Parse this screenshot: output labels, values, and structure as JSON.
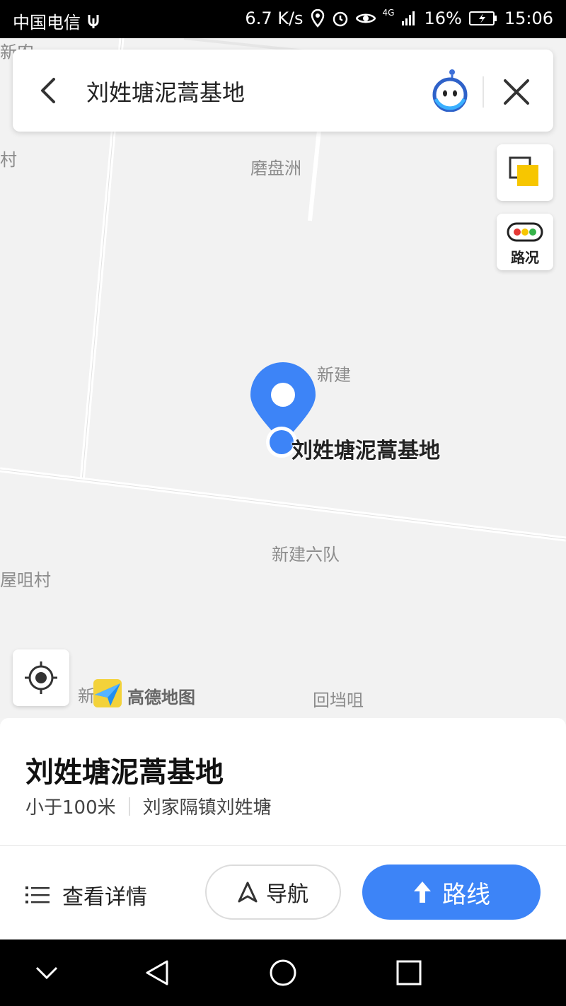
{
  "status_bar": {
    "carrier": "中国电信",
    "speed": "6.7 K/s",
    "network": "4G",
    "battery": "16%",
    "time": "15:06",
    "icons": [
      "usb-icon",
      "location-icon",
      "alarm-icon",
      "eye-icon",
      "signal-icon",
      "battery-icon"
    ]
  },
  "search": {
    "query": "刘姓塘泥蒿基地"
  },
  "map": {
    "places": {
      "xinnong": "新农",
      "cun": "村",
      "mopanzhou": "磨盘洲",
      "xinjian": "新建",
      "xinjian_liudui": "新建六队",
      "juzui_cun": "屋咀村",
      "xin": "新",
      "huidangzui": "回垱咀"
    },
    "poi_label": "刘姓塘泥蒿基地",
    "traffic_label": "路况",
    "logo_text": "高德地图",
    "colors": {
      "accent": "#3d84f7",
      "layers_yellow": "#f7c600"
    }
  },
  "card": {
    "title": "刘姓塘泥蒿基地",
    "distance": "小于100米",
    "address": "刘家隔镇刘姓塘",
    "details_label": "查看详情",
    "navigate_label": "导航",
    "route_label": "路线"
  }
}
